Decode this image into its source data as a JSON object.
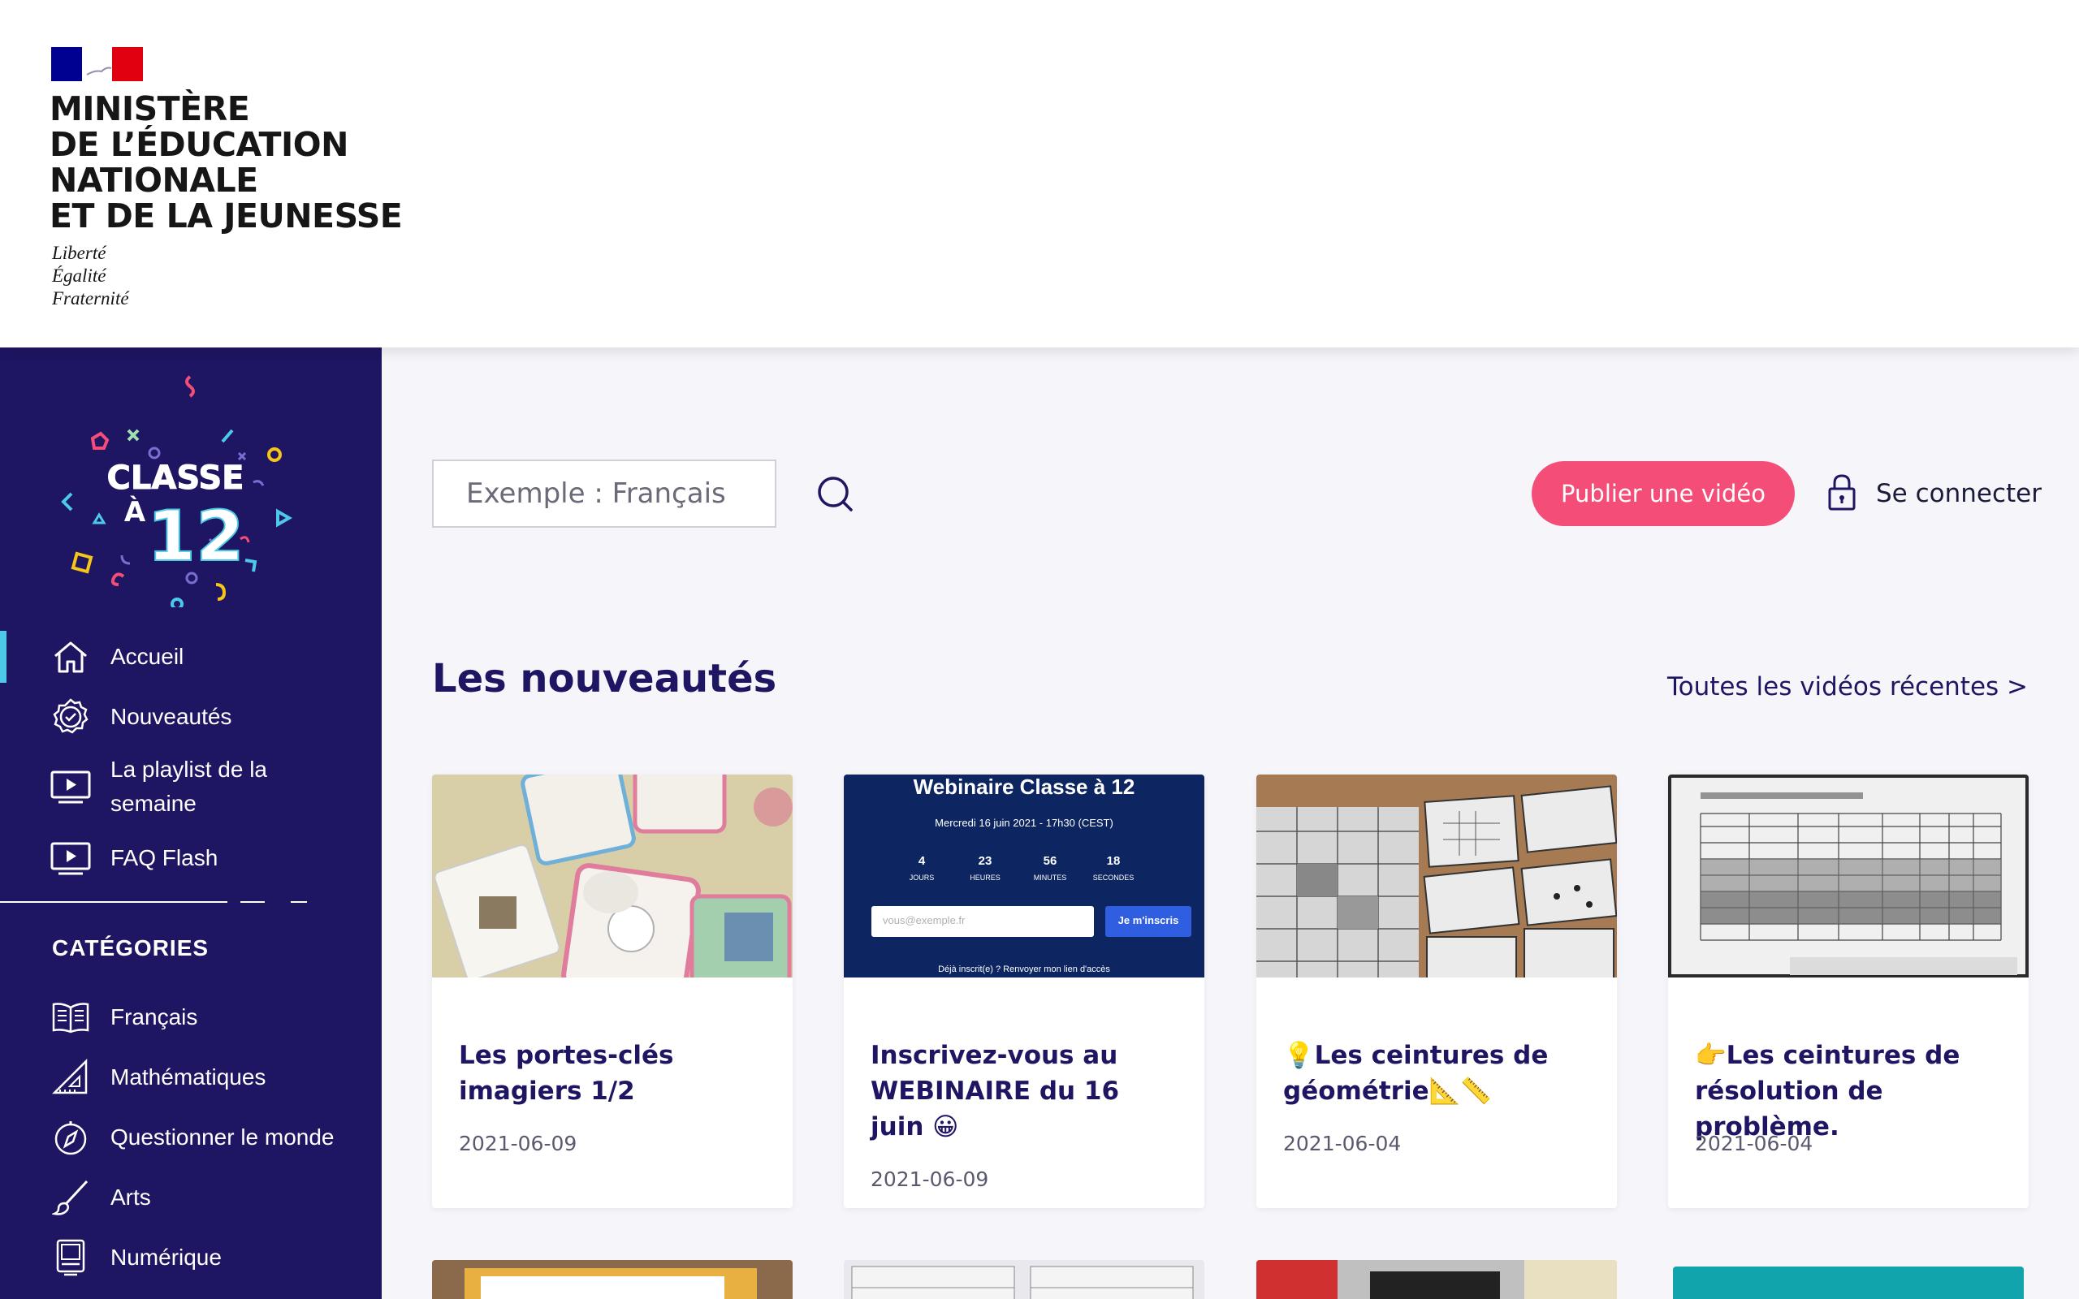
{
  "header": {
    "ministry_lines": [
      "MINISTÈRE",
      "DE L’ÉDUCATION",
      "NATIONALE",
      "ET DE LA JEUNESSE"
    ],
    "motto_lines": [
      "Liberté",
      "Égalité",
      "Fraternité"
    ]
  },
  "sidebar": {
    "logo_text": {
      "line1": "CLASSE",
      "line2": "À",
      "line3": "12"
    },
    "nav": [
      {
        "label": "Accueil",
        "icon": "home-icon",
        "active": true
      },
      {
        "label": "Nouveautés",
        "icon": "badge-check-icon"
      },
      {
        "label": "La playlist de la semaine",
        "icon": "play-screen-icon"
      },
      {
        "label": "FAQ Flash",
        "icon": "play-screen-icon"
      }
    ],
    "categories_title": "CATÉGORIES",
    "categories": [
      {
        "label": "Français",
        "icon": "book-icon"
      },
      {
        "label": "Mathématiques",
        "icon": "set-square-icon"
      },
      {
        "label": "Questionner le monde",
        "icon": "compass-icon"
      },
      {
        "label": "Arts",
        "icon": "brush-icon"
      },
      {
        "label": "Numérique",
        "icon": "device-icon"
      }
    ],
    "accent_color": "#4cc9e6",
    "background_color": "#1e1563"
  },
  "toolbar": {
    "search_placeholder": "Exemple : Français",
    "publish_label": "Publier une vidéo",
    "login_label": "Se connecter",
    "publish_color": "#f34d78"
  },
  "section": {
    "title": "Les nouveautés",
    "all_link": "Toutes les vidéos récentes >"
  },
  "cards": [
    {
      "title": "Les portes-clés imagiers 1/2",
      "date": "2021-06-09"
    },
    {
      "title": "Inscrivez-vous au WEBINAIRE du 16 juin 😀",
      "date": "2021-06-09",
      "thumb": {
        "heading": "Webinaire Classe à 12",
        "subheading": "Mercredi 16 juin 2021 - 17h30 (CEST)",
        "countdown": [
          {
            "value": "4",
            "unit": "JOURS"
          },
          {
            "value": "23",
            "unit": "HEURES"
          },
          {
            "value": "56",
            "unit": "MINUTES"
          },
          {
            "value": "18",
            "unit": "SECONDES"
          }
        ],
        "email_placeholder": "vous@exemple.fr",
        "button": "Je m'inscris",
        "footer": "Déjà inscrit(e) ? Renvoyer mon lien d'accès"
      }
    },
    {
      "title": "💡Les ceintures de géométrie📐📏",
      "date": "2021-06-04"
    },
    {
      "title": "👉Les ceintures de résolution de problème.",
      "date": "2021-06-04"
    }
  ]
}
